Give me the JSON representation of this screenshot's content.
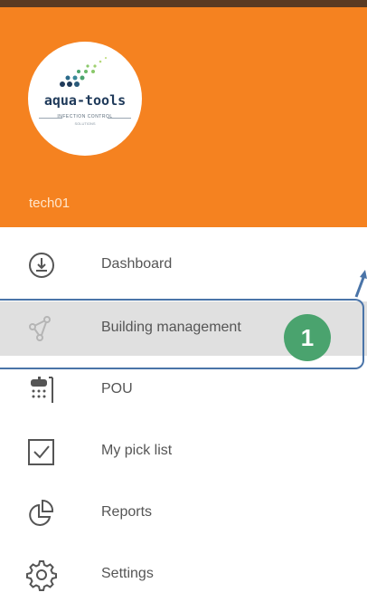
{
  "brand": {
    "name": "aqua-tools",
    "tagline": "INFECTION CONTROL",
    "tagline2": "SOLUTIONS"
  },
  "user": {
    "name": "tech01"
  },
  "menu": {
    "items": [
      {
        "label": "Dashboard",
        "icon": "dashboard-icon",
        "active": false
      },
      {
        "label": "Building management",
        "icon": "building-management-icon",
        "active": true
      },
      {
        "label": "POU",
        "icon": "pou-icon",
        "active": false
      },
      {
        "label": "My pick list",
        "icon": "pick-list-icon",
        "active": false
      },
      {
        "label": "Reports",
        "icon": "reports-icon",
        "active": false
      },
      {
        "label": "Settings",
        "icon": "settings-icon",
        "active": false
      }
    ]
  },
  "annotation": {
    "callout_number": "1",
    "color": "#4aa36e",
    "highlight_color": "#4a74a8"
  },
  "colors": {
    "header": "#f58220",
    "active_row": "#e0e0e0"
  }
}
